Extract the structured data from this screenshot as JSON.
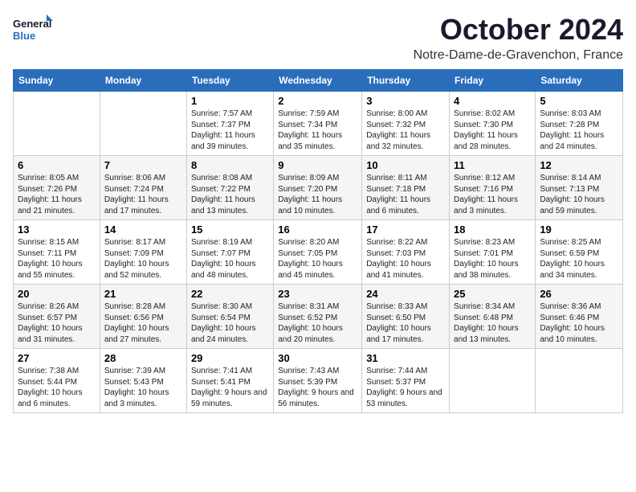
{
  "header": {
    "logo_line1": "General",
    "logo_line2": "Blue",
    "month": "October 2024",
    "location": "Notre-Dame-de-Gravenchon, France"
  },
  "weekdays": [
    "Sunday",
    "Monday",
    "Tuesday",
    "Wednesday",
    "Thursday",
    "Friday",
    "Saturday"
  ],
  "weeks": [
    [
      {
        "day": "",
        "info": ""
      },
      {
        "day": "",
        "info": ""
      },
      {
        "day": "1",
        "info": "Sunrise: 7:57 AM\nSunset: 7:37 PM\nDaylight: 11 hours and 39 minutes."
      },
      {
        "day": "2",
        "info": "Sunrise: 7:59 AM\nSunset: 7:34 PM\nDaylight: 11 hours and 35 minutes."
      },
      {
        "day": "3",
        "info": "Sunrise: 8:00 AM\nSunset: 7:32 PM\nDaylight: 11 hours and 32 minutes."
      },
      {
        "day": "4",
        "info": "Sunrise: 8:02 AM\nSunset: 7:30 PM\nDaylight: 11 hours and 28 minutes."
      },
      {
        "day": "5",
        "info": "Sunrise: 8:03 AM\nSunset: 7:28 PM\nDaylight: 11 hours and 24 minutes."
      }
    ],
    [
      {
        "day": "6",
        "info": "Sunrise: 8:05 AM\nSunset: 7:26 PM\nDaylight: 11 hours and 21 minutes."
      },
      {
        "day": "7",
        "info": "Sunrise: 8:06 AM\nSunset: 7:24 PM\nDaylight: 11 hours and 17 minutes."
      },
      {
        "day": "8",
        "info": "Sunrise: 8:08 AM\nSunset: 7:22 PM\nDaylight: 11 hours and 13 minutes."
      },
      {
        "day": "9",
        "info": "Sunrise: 8:09 AM\nSunset: 7:20 PM\nDaylight: 11 hours and 10 minutes."
      },
      {
        "day": "10",
        "info": "Sunrise: 8:11 AM\nSunset: 7:18 PM\nDaylight: 11 hours and 6 minutes."
      },
      {
        "day": "11",
        "info": "Sunrise: 8:12 AM\nSunset: 7:16 PM\nDaylight: 11 hours and 3 minutes."
      },
      {
        "day": "12",
        "info": "Sunrise: 8:14 AM\nSunset: 7:13 PM\nDaylight: 10 hours and 59 minutes."
      }
    ],
    [
      {
        "day": "13",
        "info": "Sunrise: 8:15 AM\nSunset: 7:11 PM\nDaylight: 10 hours and 55 minutes."
      },
      {
        "day": "14",
        "info": "Sunrise: 8:17 AM\nSunset: 7:09 PM\nDaylight: 10 hours and 52 minutes."
      },
      {
        "day": "15",
        "info": "Sunrise: 8:19 AM\nSunset: 7:07 PM\nDaylight: 10 hours and 48 minutes."
      },
      {
        "day": "16",
        "info": "Sunrise: 8:20 AM\nSunset: 7:05 PM\nDaylight: 10 hours and 45 minutes."
      },
      {
        "day": "17",
        "info": "Sunrise: 8:22 AM\nSunset: 7:03 PM\nDaylight: 10 hours and 41 minutes."
      },
      {
        "day": "18",
        "info": "Sunrise: 8:23 AM\nSunset: 7:01 PM\nDaylight: 10 hours and 38 minutes."
      },
      {
        "day": "19",
        "info": "Sunrise: 8:25 AM\nSunset: 6:59 PM\nDaylight: 10 hours and 34 minutes."
      }
    ],
    [
      {
        "day": "20",
        "info": "Sunrise: 8:26 AM\nSunset: 6:57 PM\nDaylight: 10 hours and 31 minutes."
      },
      {
        "day": "21",
        "info": "Sunrise: 8:28 AM\nSunset: 6:56 PM\nDaylight: 10 hours and 27 minutes."
      },
      {
        "day": "22",
        "info": "Sunrise: 8:30 AM\nSunset: 6:54 PM\nDaylight: 10 hours and 24 minutes."
      },
      {
        "day": "23",
        "info": "Sunrise: 8:31 AM\nSunset: 6:52 PM\nDaylight: 10 hours and 20 minutes."
      },
      {
        "day": "24",
        "info": "Sunrise: 8:33 AM\nSunset: 6:50 PM\nDaylight: 10 hours and 17 minutes."
      },
      {
        "day": "25",
        "info": "Sunrise: 8:34 AM\nSunset: 6:48 PM\nDaylight: 10 hours and 13 minutes."
      },
      {
        "day": "26",
        "info": "Sunrise: 8:36 AM\nSunset: 6:46 PM\nDaylight: 10 hours and 10 minutes."
      }
    ],
    [
      {
        "day": "27",
        "info": "Sunrise: 7:38 AM\nSunset: 5:44 PM\nDaylight: 10 hours and 6 minutes."
      },
      {
        "day": "28",
        "info": "Sunrise: 7:39 AM\nSunset: 5:43 PM\nDaylight: 10 hours and 3 minutes."
      },
      {
        "day": "29",
        "info": "Sunrise: 7:41 AM\nSunset: 5:41 PM\nDaylight: 9 hours and 59 minutes."
      },
      {
        "day": "30",
        "info": "Sunrise: 7:43 AM\nSunset: 5:39 PM\nDaylight: 9 hours and 56 minutes."
      },
      {
        "day": "31",
        "info": "Sunrise: 7:44 AM\nSunset: 5:37 PM\nDaylight: 9 hours and 53 minutes."
      },
      {
        "day": "",
        "info": ""
      },
      {
        "day": "",
        "info": ""
      }
    ]
  ]
}
